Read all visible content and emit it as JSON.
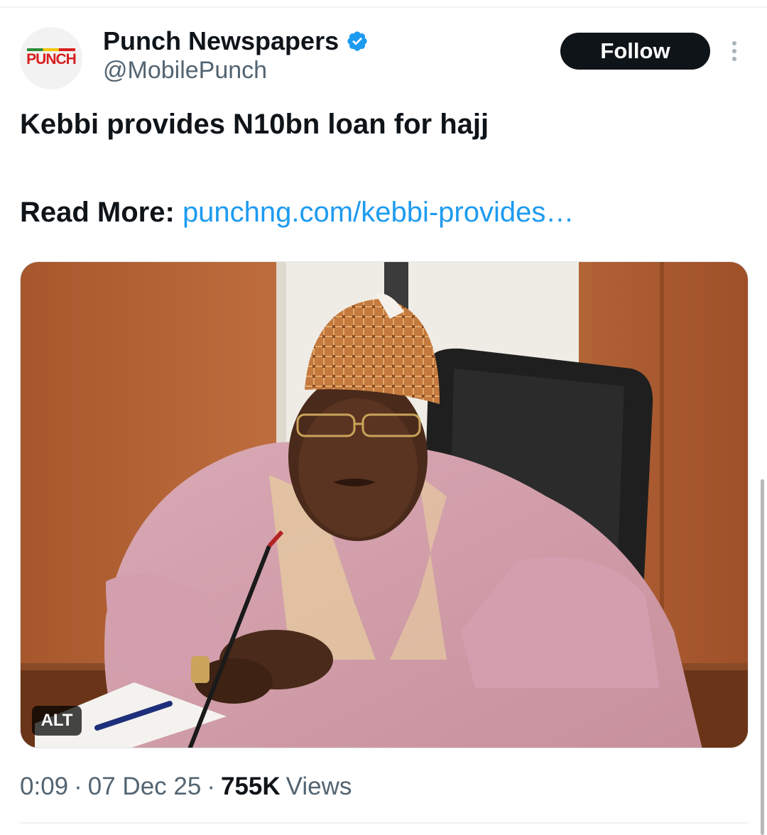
{
  "author": {
    "avatar_text": "PUNCH",
    "display_name": "Punch Newspapers",
    "handle": "@MobilePunch",
    "verified_icon": "verified-badge-icon",
    "accent_color": "#1d9bf0"
  },
  "actions": {
    "follow_label": "Follow",
    "more_icon": "more-vertical-icon"
  },
  "post": {
    "text": "Kebbi provides N10bn loan for hajj",
    "read_more_label": "Read More:",
    "link_text": "punchng.com/kebbi-provides…"
  },
  "media": {
    "alt_label": "ALT"
  },
  "meta": {
    "time": "0:09",
    "separator": "·",
    "date": "07 Dec 25",
    "views_count": "755K",
    "views_label": "Views"
  }
}
